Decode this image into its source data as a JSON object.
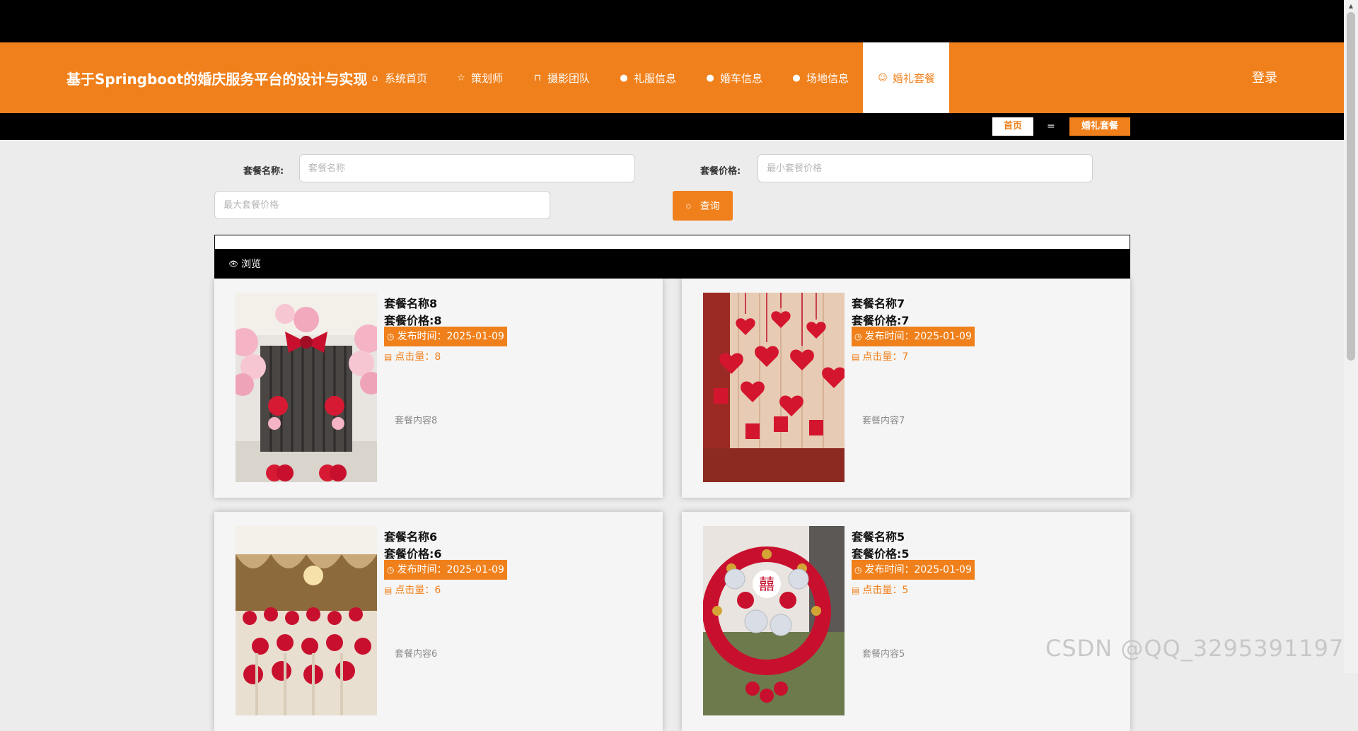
{
  "header": {
    "site_title": "基于Springboot的婚庆服务平台的设计与实现",
    "nav": [
      {
        "label": "系统首页",
        "icon": "home-icon"
      },
      {
        "label": "策划师",
        "icon": "star-icon"
      },
      {
        "label": "摄影团队",
        "icon": "bag-icon"
      },
      {
        "label": "礼服信息",
        "icon": "exclamation-circle-icon"
      },
      {
        "label": "婚车信息",
        "icon": "question-circle-icon"
      },
      {
        "label": "场地信息",
        "icon": "info-circle-icon"
      },
      {
        "label": "婚礼套餐",
        "icon": "smile-icon",
        "active": true
      }
    ],
    "login_label": "登录"
  },
  "breadcrumb": {
    "home": "首页",
    "separator": "=",
    "current": "婚礼套餐"
  },
  "search": {
    "name_label": "套餐名称:",
    "name_placeholder": "套餐名称",
    "price_label": "套餐价格:",
    "min_price_placeholder": "最小套餐价格",
    "max_price_placeholder": "最大套餐价格",
    "button_label": "查询"
  },
  "list": {
    "header_label": "浏览",
    "items": [
      {
        "name": "套餐名称8",
        "price": "套餐价格:8",
        "time": "发布时间：2025-01-09",
        "clicks": "点击量：8",
        "content": "套餐内容8"
      },
      {
        "name": "套餐名称7",
        "price": "套餐价格:7",
        "time": "发布时间：2025-01-09",
        "clicks": "点击量：7",
        "content": "套餐内容7"
      },
      {
        "name": "套餐名称6",
        "price": "套餐价格:6",
        "time": "发布时间：2025-01-09",
        "clicks": "点击量：6",
        "content": "套餐内容6"
      },
      {
        "name": "套餐名称5",
        "price": "套餐价格:5",
        "time": "发布时间：2025-01-09",
        "clicks": "点击量：5",
        "content": "套餐内容5"
      }
    ]
  },
  "watermark": "CSDN @QQ_3295391197",
  "colors": {
    "accent": "#f0801b",
    "bar": "#000000",
    "background": "#ececec"
  }
}
